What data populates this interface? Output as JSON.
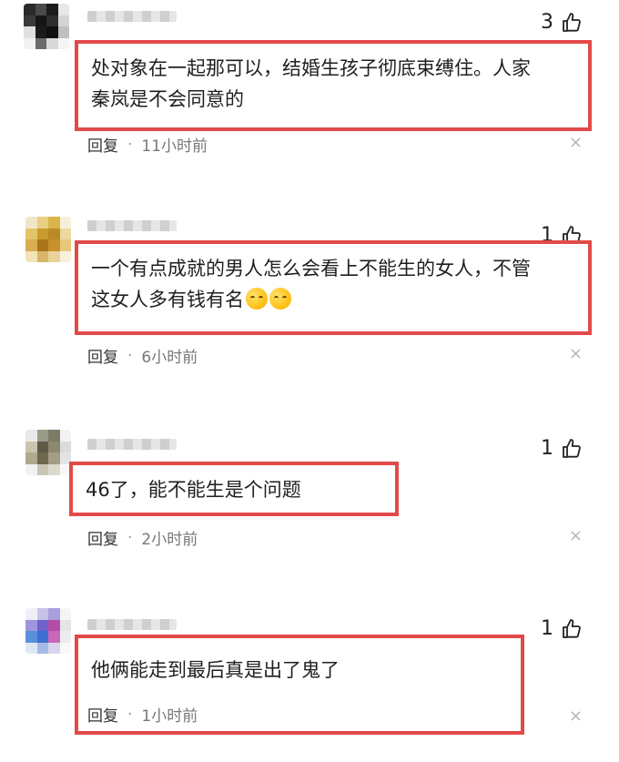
{
  "comments": [
    {
      "likes": "3",
      "text_lines": [
        "处对象在一起那可以，结婚生孩子彻底束缚住。人家",
        "秦岚是不会同意的"
      ],
      "reply_label": "回复",
      "time": "11小时前",
      "close_icon": "×"
    },
    {
      "likes": "1",
      "text_lines": [
        "一个有点成就的男人怎么会看上不能生的女人，不管",
        "这女人多有钱有名"
      ],
      "emoji": [
        "smirk-emoji",
        "smirk-emoji"
      ],
      "reply_label": "回复",
      "time": "6小时前",
      "close_icon": "×"
    },
    {
      "likes": "1",
      "text_lines": [
        "46了，能不能生是个问题"
      ],
      "reply_label": "回复",
      "time": "2小时前",
      "close_icon": "×"
    },
    {
      "likes": "1",
      "text_lines": [
        "他俩能走到最后真是出了鬼了"
      ],
      "reply_label": "回复",
      "time": "1小时前",
      "close_icon": "×"
    }
  ],
  "colors": {
    "highlight_border": "#e24a4a",
    "meta_text": "#777777"
  },
  "separator": "·"
}
